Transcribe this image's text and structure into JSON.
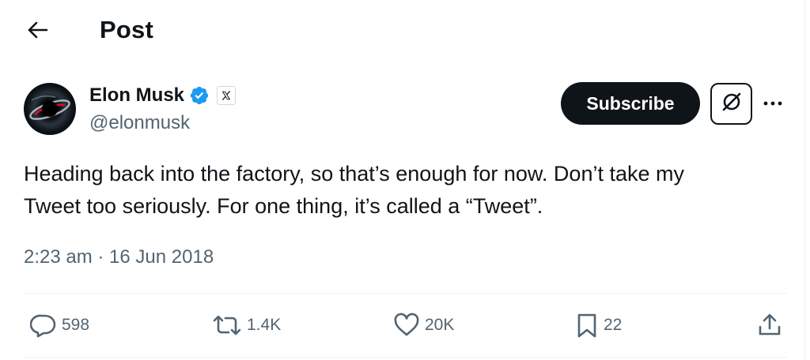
{
  "header": {
    "title": "Post",
    "back_icon": "arrow-left-icon"
  },
  "author": {
    "display_name": "Elon Musk",
    "handle": "@elonmusk",
    "verified_icon": "verified-badge-icon",
    "affiliate_icon": "x-logo-icon"
  },
  "actions": {
    "subscribe_label": "Subscribe",
    "grok_icon": "grok-icon",
    "more_icon": "more-horizontal-icon"
  },
  "tweet": {
    "text": "Heading back into the factory, so that’s enough for now. Don’t take my\nTweet too seriously. For one thing, it’s called a “Tweet”.",
    "timestamp": "2:23 am · 16 Jun 2018"
  },
  "engagement": {
    "replies": "598",
    "reposts": "1.4K",
    "likes": "20K",
    "bookmarks": "22"
  },
  "colors": {
    "text_primary": "#0f1419",
    "text_secondary": "#536471",
    "verified_blue": "#1d9bf0",
    "divider": "#eff3f4"
  }
}
